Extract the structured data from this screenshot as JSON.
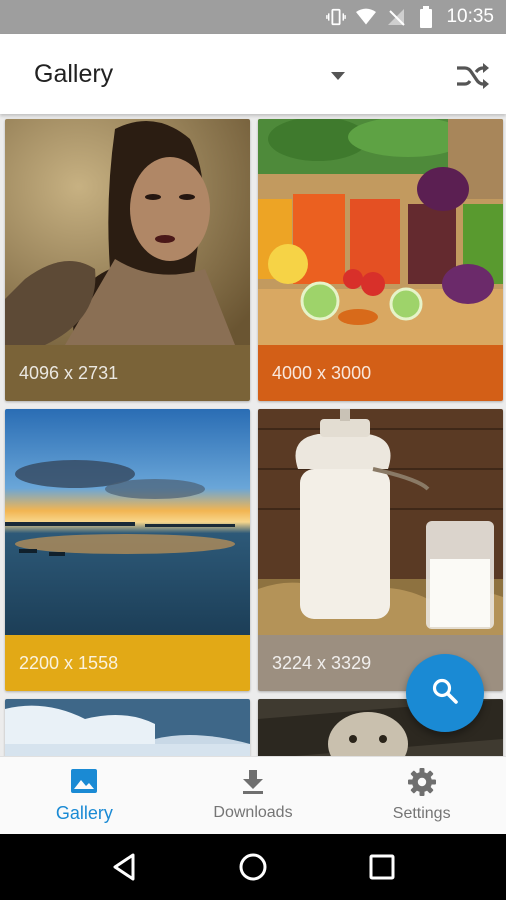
{
  "status_bar": {
    "time": "10:35"
  },
  "app_bar": {
    "title": "Gallery",
    "dropdown_icon": "arrow-drop-down-icon",
    "shuffle_icon": "shuffle-icon"
  },
  "gallery": {
    "items": [
      {
        "caption": "4096 x 2731",
        "caption_color": "#7a6338",
        "subject": "portrait-woman"
      },
      {
        "caption": "4000 x 3000",
        "caption_color": "#d35f17",
        "subject": "juices-vegetables"
      },
      {
        "caption": "2200 x 1558",
        "caption_color": "#e2a916",
        "subject": "sunset-lake"
      },
      {
        "caption": "3224 x 3329",
        "caption_color": "#9c8f80",
        "subject": "milk-jug"
      },
      {
        "caption": "",
        "caption_color": "#ffffff",
        "subject": "snow-ice"
      },
      {
        "caption": "",
        "caption_color": "#ffffff",
        "subject": "snow-leopard"
      }
    ]
  },
  "fab": {
    "icon": "search-icon",
    "color": "#1a8ad4"
  },
  "bottom_nav": {
    "items": [
      {
        "label": "Gallery",
        "icon": "image-icon",
        "active": true
      },
      {
        "label": "Downloads",
        "icon": "download-icon",
        "active": false
      },
      {
        "label": "Settings",
        "icon": "gear-icon",
        "active": false
      }
    ]
  },
  "system_nav": {
    "back_icon": "back-triangle-icon",
    "home_icon": "home-circle-icon",
    "recents_icon": "recents-square-icon"
  }
}
